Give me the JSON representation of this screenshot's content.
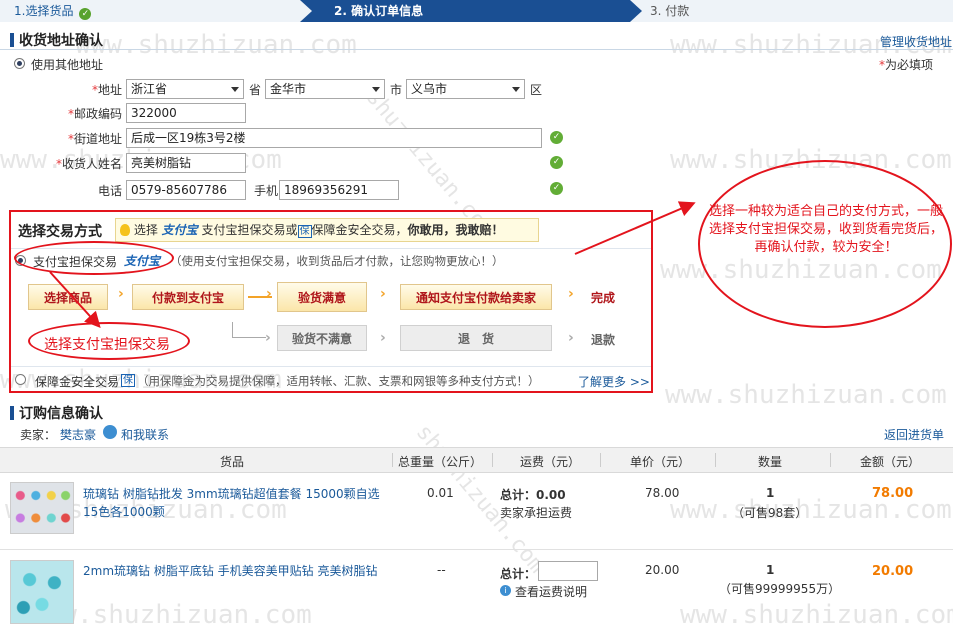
{
  "steps": {
    "step1": "1.选择货品",
    "step2": "2. 确认订单信息",
    "step3": "3. 付款"
  },
  "address": {
    "title": "收货地址确认",
    "manage_link": "管理收货地址",
    "use_other": "使用其他地址",
    "required_note": "为必填项",
    "star": "*",
    "region_label": "地址",
    "province": "浙江省",
    "province_unit": "省",
    "city": "金华市",
    "city_unit": "市",
    "district": "义乌市",
    "district_unit": "区",
    "zip_label": "邮政编码",
    "zip": "322000",
    "street_label": "街道地址",
    "street": "后成一区19栋3号2楼",
    "name_label": "收货人姓名",
    "name": "亮美树脂钻",
    "phone_label": "电话",
    "phone": "0579-85607786",
    "mobile_label": "手机",
    "mobile": "18969356291"
  },
  "payment": {
    "title": "选择交易方式",
    "tip_select": "选择",
    "tip_alipay": "支付宝",
    "tip_mid": "支付宝担保交易或",
    "tip_bao": "保",
    "tip_mid2": "保障金安全交易，",
    "tip_bold": "你敢用，我敢赔！",
    "alipay_option": "支付宝担保交易",
    "alipay_logo": "支付宝",
    "alipay_desc": "（使用支付宝担保交易，收到货品后才付款，让您购物更放心！）",
    "flow1": "选择商品",
    "flow2": "付款到支付宝",
    "flow3": "验货满意",
    "flow4": "通知支付宝付款给卖家",
    "flow5": "完成",
    "flow6": "验货不满意",
    "flow7": "退　货",
    "flow8": "退款",
    "chev": "›",
    "deposit_option": "保障金安全交易",
    "deposit_bao": "保",
    "deposit_desc": "（用保障金为交易提供保障，适用转帐、汇款、支票和网银等多种支付方式！）",
    "learn_more": "了解更多 >>"
  },
  "annotations": {
    "callout": "选择一种较为适合自己的支付方式，一般选择支付宝担保交易，收到货看完货后，再确认付款，较为安全！",
    "select_alipay": "选择支付宝担保交易"
  },
  "order": {
    "title": "订购信息确认",
    "seller_label": "卖家：",
    "seller": "樊志豪",
    "contact": "和我联系",
    "back_link": "返回进货单",
    "headers": [
      "货品",
      "总重量（公斤）",
      "运费（元）",
      "单价（元）",
      "数量",
      "金额（元）"
    ],
    "rows": [
      {
        "name": "琉璃钻 树脂钻批发 3mm琉璃钻超值套餐 15000颗自选15色各1000颗",
        "weight": "0.01",
        "freight_label": "总计：",
        "freight_value": "0.00",
        "freight_note": "卖家承担运费",
        "price": "78.00",
        "qty": "1",
        "stock": "（可售98套）",
        "amount": "78.00"
      },
      {
        "name": "2mm琉璃钻 树脂平底钻 手机美容美甲贴钻 亮美树脂钻",
        "weight": "--",
        "freight_label": "总计：",
        "freight_value": "",
        "freight_note": "查看运费说明",
        "price": "20.00",
        "qty": "1",
        "stock": "（可售99999955万）",
        "amount": "20.00"
      }
    ]
  },
  "watermark": "www.shuzhizuan.com",
  "watermark_diag": "shuzhizuan.com",
  "colors": {
    "primary": "#1a4f93",
    "link": "#1b5a9a",
    "annotation": "#e3141d",
    "ok": "#62ad36",
    "amount": "#f27b00"
  }
}
